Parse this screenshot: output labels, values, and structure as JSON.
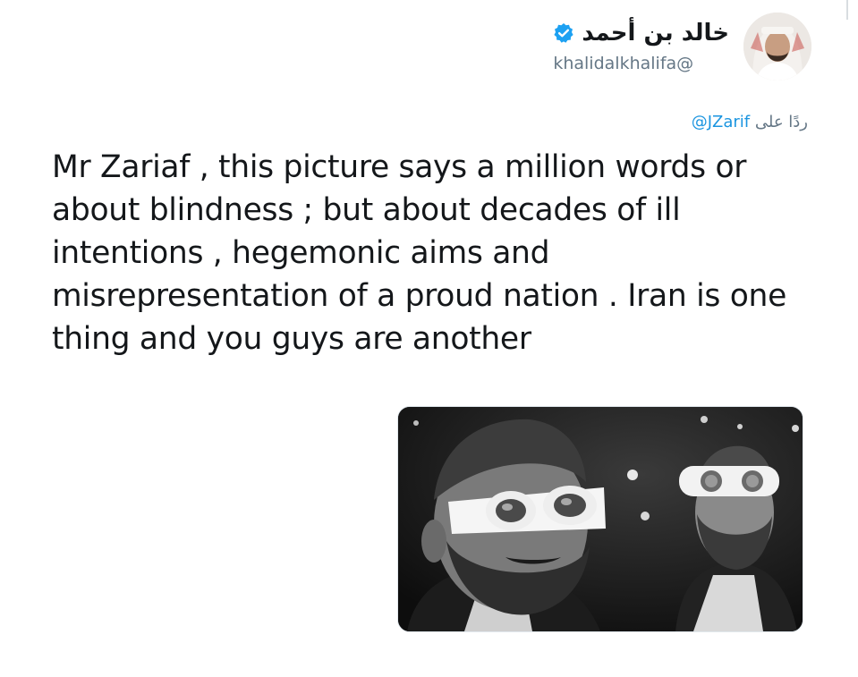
{
  "tweet": {
    "author_name": "خالد بن أحمد",
    "handle": "@khalidalkhalifa",
    "reply_prefix": "ردًا على",
    "reply_mention": "@JZarif",
    "text": "Mr Zariaf , this picture says a million words or about blindness ; but about decades of ill intentions , hegemonic aims and misrepresentation of a proud nation . Iran is one thing and you guys are another",
    "verified": true,
    "verified_color": "#1da1f2"
  },
  "media": {
    "kind": "photo",
    "tone": "black-and-white"
  }
}
